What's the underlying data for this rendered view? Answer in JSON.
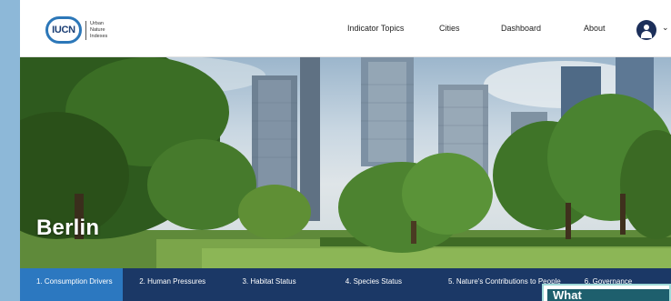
{
  "header": {
    "logo_text": [
      "Urban",
      "Nature",
      "Indexes"
    ],
    "logo_mark": "IUCN",
    "nav": [
      "Indicator Topics",
      "Cities",
      "Dashboard",
      "About"
    ],
    "user_icon": "user-circle-icon",
    "user_chevron": "chevron-down-icon"
  },
  "hero": {
    "city": "Berlin"
  },
  "tabs": [
    {
      "label": "1. Consumption Drivers",
      "active": true
    },
    {
      "label": "2. Human Pressures",
      "active": false
    },
    {
      "label": "3. Habitat Status",
      "active": false
    },
    {
      "label": "4. Species Status",
      "active": false
    },
    {
      "label": "5. Nature's Contributions to People",
      "active": false
    },
    {
      "label": "6. Governance",
      "active": false
    }
  ],
  "popup": {
    "title": "What"
  },
  "colors": {
    "accent_blue": "#2c78c0",
    "tab_bar": "#1b3866",
    "popup_teal": "#1e5f6d"
  }
}
